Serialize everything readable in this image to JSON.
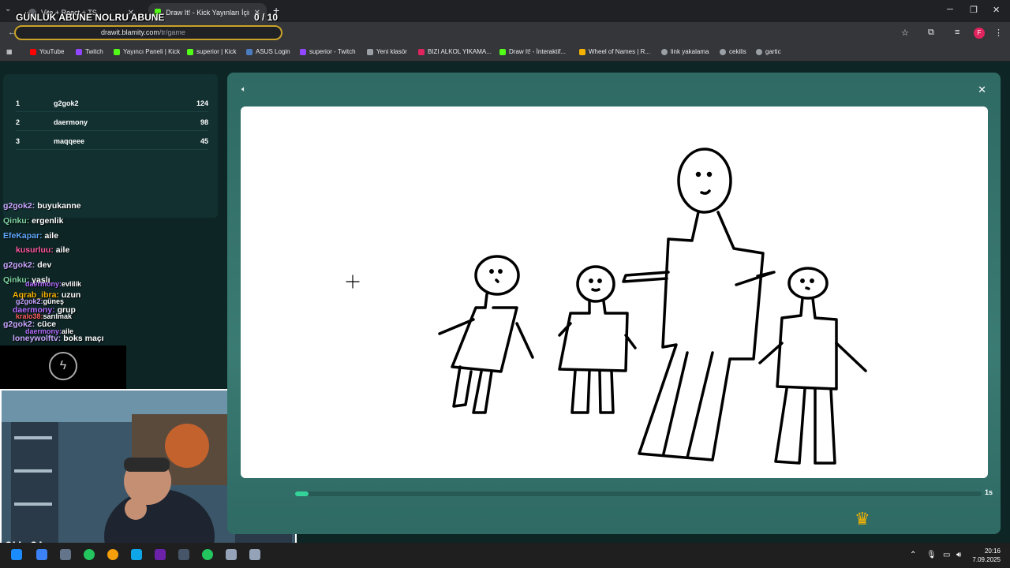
{
  "browser": {
    "tabs": [
      {
        "label": "Vite + React + TS"
      },
      {
        "label": "Draw It! - Kick Yayınları İçin Çizi"
      }
    ],
    "url_domain": "drawit.blamity.com",
    "url_path": "/tr/game",
    "profile_initial": "F"
  },
  "overlay": {
    "title": "GÜNLÜK ABUNE NOLRU ABUNE",
    "counter": "0  / 10"
  },
  "bookmarks": [
    {
      "label": "YouTube",
      "color": "#ff0000"
    },
    {
      "label": "Twitch",
      "color": "#9146ff"
    },
    {
      "label": "Yayıncı Paneli | Kick",
      "color": "#53fc18"
    },
    {
      "label": "superior | Kick",
      "color": "#53fc18"
    },
    {
      "label": "ASUS Login",
      "color": "#4a7cbf"
    },
    {
      "label": "superior - Twitch",
      "color": "#9146ff"
    },
    {
      "label": "Yeni klasör",
      "color": "#9aa0a6"
    },
    {
      "label": "BIZI ALKOL YIKAMA...",
      "color": "#e0245e"
    },
    {
      "label": "Draw It! - İnteraktif...",
      "color": "#53fc18"
    },
    {
      "label": "Wheel of Names | R...",
      "color": "#f5b301"
    },
    {
      "label": "link yakalama",
      "color": "#9aa0a6"
    },
    {
      "label": "cekilis",
      "color": "#9aa0a6"
    },
    {
      "label": "gartic",
      "color": "#9aa0a6"
    }
  ],
  "leaderboard": [
    {
      "rank": "1",
      "name": "g2gok2",
      "score": "124"
    },
    {
      "rank": "2",
      "name": "daermony",
      "score": "98"
    },
    {
      "rank": "3",
      "name": "maqqeee",
      "score": "45"
    }
  ],
  "chat": [
    {
      "user": "g2gok2:",
      "text": "buyukanne",
      "color": "#c9a7ff"
    },
    {
      "user": "Qinku:",
      "text": "ergenlik",
      "color": "#7fd6a4"
    },
    {
      "user": "EfeKapar:",
      "text": "aile",
      "color": "#5fa8ff"
    },
    {
      "user": "kusurluu:",
      "text": "aile",
      "color": "#ff5aa0"
    },
    {
      "user": "g2gok2:",
      "text": "dev",
      "color": "#c9a7ff"
    },
    {
      "user": "Qinku:",
      "text": "yaşlı",
      "color": "#7fd6a4"
    },
    {
      "user": "daermony:",
      "text": "evlilik",
      "color": "#b36bff"
    },
    {
      "user": "Aqrab_ibra:",
      "text": "uzun",
      "color": "#f5b301"
    },
    {
      "user": "g2gok2:",
      "text": "güneş",
      "color": "#c9a7ff"
    },
    {
      "user": "daermony:",
      "text": "grup",
      "color": "#b36bff"
    },
    {
      "user": "kralo38:",
      "text": "sarılmak",
      "color": "#ff5a5a"
    },
    {
      "user": "g2gok2:",
      "text": "cüce",
      "color": "#c9a7ff"
    },
    {
      "user": "daermony:",
      "text": "aile",
      "color": "#b36bff"
    },
    {
      "user": "loneywolftv:",
      "text": "boks maçı",
      "color": "#c9a7ff"
    }
  ],
  "webcam": {
    "label": "OW OL"
  },
  "game": {
    "progress": 0.02,
    "time_label": "1s"
  },
  "taskbar": {
    "time": "20:16",
    "date": "7.09.2025"
  }
}
